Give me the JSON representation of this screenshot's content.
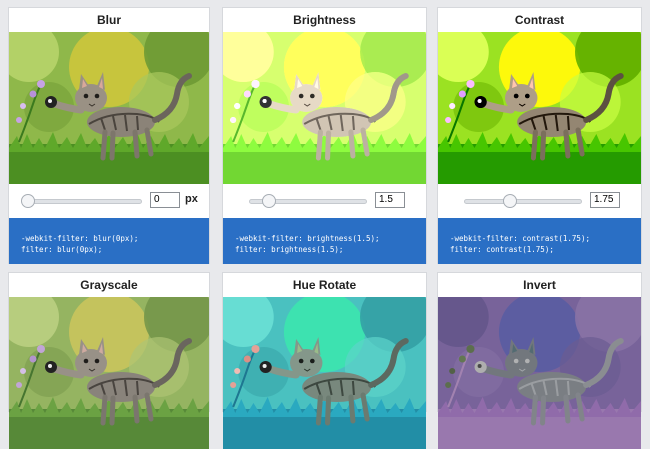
{
  "cards": [
    {
      "title": "Blur",
      "value": "0",
      "unit": "px",
      "slider_fraction": 0.0,
      "code_line1": "-webkit-filter: blur(0px);",
      "code_line2": "filter: blur(0px);"
    },
    {
      "title": "Brightness",
      "value": "1.5",
      "unit": "",
      "slider_fraction": 0.15,
      "code_line1": "-webkit-filter: brightness(1.5);",
      "code_line2": "filter: brightness(1.5);"
    },
    {
      "title": "Contrast",
      "value": "1.75",
      "unit": "",
      "slider_fraction": 0.4,
      "code_line1": "-webkit-filter: contrast(1.75);",
      "code_line2": "filter: contrast(1.75);"
    },
    {
      "title": "Grayscale"
    },
    {
      "title": "Hue Rotate"
    },
    {
      "title": "Invert"
    }
  ],
  "colors": {
    "code_background": "#2a6fc5",
    "page_background": "#e8e9ec"
  }
}
